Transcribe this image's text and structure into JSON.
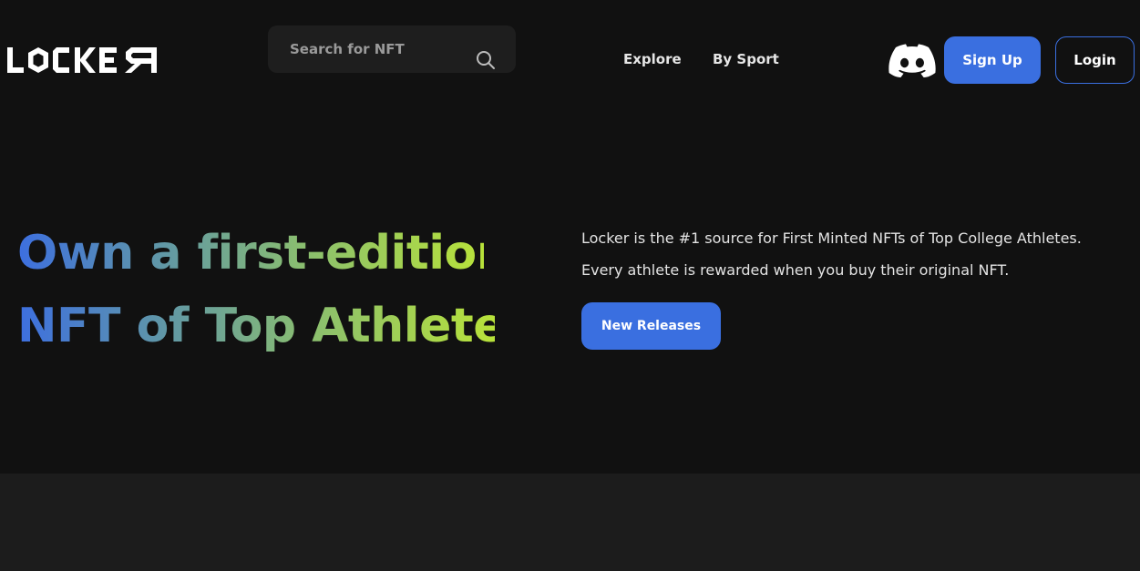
{
  "header": {
    "logo_text": "LOCKER",
    "search": {
      "placeholder": "Search for NFT",
      "value": "",
      "icon": "search-icon"
    },
    "nav": [
      {
        "label": "Explore"
      },
      {
        "label": "By Sport"
      }
    ],
    "discord_icon": "discord-icon",
    "signup_label": "Sign Up",
    "login_label": "Login"
  },
  "hero": {
    "title_line1": "Own a first-edition",
    "title_line2": "NFT of Top Athletes",
    "description_line1": "Locker is the #1 source for First Minted NFTs of Top College Athletes.",
    "description_line2": "Every athlete is rewarded when you buy their original NFT.",
    "cta_label": "New Releases"
  },
  "colors": {
    "background_top": "#111111",
    "background_bottom": "#1c1c1c",
    "accent_blue": "#3a6fe0",
    "gradient_start": "#3d6fe0",
    "gradient_end": "#b8e23a"
  }
}
